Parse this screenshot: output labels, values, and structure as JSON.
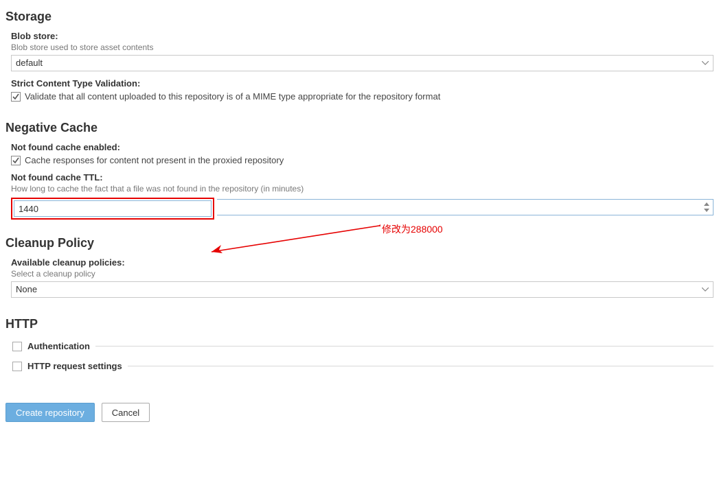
{
  "storage": {
    "title": "Storage",
    "blob_label": "Blob store:",
    "blob_help": "Blob store used to store asset contents",
    "blob_value": "default",
    "strict_label": "Strict Content Type Validation:",
    "strict_text": "Validate that all content uploaded to this repository is of a MIME type appropriate for the repository format"
  },
  "negativeCache": {
    "title": "Negative Cache",
    "enabled_label": "Not found cache enabled:",
    "enabled_text": "Cache responses for content not present in the proxied repository",
    "ttl_label": "Not found cache TTL:",
    "ttl_help": "How long to cache the fact that a file was not found in the repository (in minutes)",
    "ttl_value": "1440"
  },
  "cleanup": {
    "title": "Cleanup Policy",
    "avail_label": "Available cleanup policies:",
    "avail_help": "Select a cleanup policy",
    "avail_value": "None"
  },
  "http": {
    "title": "HTTP",
    "auth_label": "Authentication",
    "req_label": "HTTP request settings"
  },
  "buttons": {
    "create": "Create repository",
    "cancel": "Cancel"
  },
  "annotation": {
    "text": "修改为288000"
  }
}
